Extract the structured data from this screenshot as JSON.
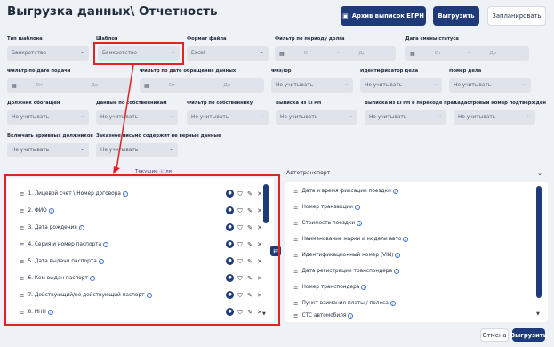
{
  "page_title": "Выгрузка данных\\ Отчетность",
  "header_buttons": {
    "archive": "Архив выписок ЕГРН",
    "export": "Выгрузить",
    "schedule": "Запланировать"
  },
  "filters_row1": {
    "tip_shablona": {
      "label": "Тип шаблона",
      "value": "Банкротство"
    },
    "shablon": {
      "label": "Шаблон",
      "value": "Банкротство"
    },
    "format": {
      "label": "Формат файла",
      "value": "Excel"
    },
    "period_dolga": {
      "label": "Фильтр по периоду долга",
      "from": "От",
      "dash": "-",
      "to": "До"
    },
    "data_smeny": {
      "label": "Дата смены статуса",
      "from": "От",
      "dash": "-",
      "to": "До"
    }
  },
  "filters_row2": {
    "data_podachi": {
      "label": "Фильтр по дате подачи",
      "from": "От",
      "dash": "-",
      "to": "До"
    },
    "data_obrascheniya": {
      "label": "Фильтр по дате обращения данных",
      "from": "От",
      "dash": "-",
      "to": "До"
    },
    "fiz_yur": {
      "label": "Физ/юр",
      "value": "Не учитывать"
    },
    "identifikator": {
      "label": "Идентификатор дела",
      "value": "Не учитывать"
    },
    "nomer_dela": {
      "label": "Номер дела",
      "value": "Не учитывать"
    }
  },
  "filters_row3": {
    "dolzhnik": {
      "label": "Должник обогащен",
      "value": "Не учитывать"
    },
    "dannye_sobstv": {
      "label": "Данные по собственникам",
      "value": "Не учитывать"
    },
    "filtr_sobstv": {
      "label": "Фильтр по собственнику",
      "value": "Не учитывать"
    },
    "vypiska": {
      "label": "Выписка из ЕГРН",
      "value": "Не учитывать"
    },
    "vypiska_perehod": {
      "label": "Выписка из ЕГРН о переходе прав",
      "value": "Не учитывать"
    },
    "kadastr": {
      "label": "Кадастровый номер подтвержден",
      "value": "Не учитывать"
    }
  },
  "filters_row4": {
    "arhivnye": {
      "label": "Включать архивных должников",
      "value": "Не учитывать"
    },
    "zakaznoe": {
      "label": "Заказное письмо содержит не верные данные",
      "value": "Не учитывать"
    }
  },
  "left_panel": {
    "header": "Текущие поля",
    "items": [
      "1. Лицевой счет \\ Номер договора",
      "2. ФИО",
      "3. Дата рождения",
      "4. Серия и номер паспорта",
      "5. Дата выдачи паспорта",
      "6. Кем выдан паспорт",
      "7. Действующий/не действующий паспорт",
      "8. ИНН"
    ]
  },
  "right_panel": {
    "dropdown": "Автотранспорт",
    "items": [
      "Дата и время фиксации поездки",
      "Номер транзакции",
      "Стоимость поездки",
      "Наименование марки и модели авто",
      "Идентификационный номер (VIN)",
      "Дата регистрации транспондера",
      "Номер транспондера",
      "Пункт взимания платы / полоса",
      "СТС автомобиля"
    ]
  },
  "footer_buttons": {
    "back": "Отмена",
    "export": "Выгрузить"
  },
  "colors": {
    "accent": "#1f3a78",
    "highlight": "#e02424"
  }
}
